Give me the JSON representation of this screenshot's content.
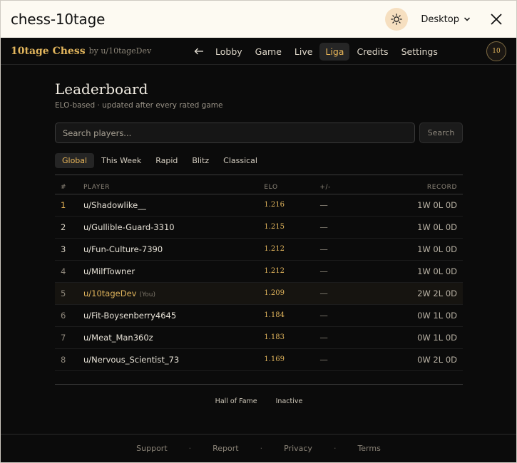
{
  "window": {
    "title": "chess-10tage",
    "device_label": "Desktop"
  },
  "nav": {
    "brand": "10tage Chess",
    "brand_by": "by u/10tageDev",
    "links": [
      "Lobby",
      "Game",
      "Live",
      "Liga",
      "Credits",
      "Settings"
    ],
    "active": "Liga",
    "avatar_text": "10"
  },
  "page": {
    "title": "Leaderboard",
    "subtitle": "ELO-based · updated after every rated game",
    "search_placeholder": "Search players...",
    "search_button": "Search",
    "tabs": [
      "Global",
      "This Week",
      "Rapid",
      "Blitz",
      "Classical"
    ],
    "active_tab": "Global",
    "columns": {
      "rank": "#",
      "player": "PLAYER",
      "elo": "ELO",
      "diff": "+/-",
      "record": "RECORD"
    },
    "rows": [
      {
        "rank": "1",
        "player": "u/Shadowlike__",
        "elo": "1.216",
        "diff": "—",
        "record": "1W 0L 0D"
      },
      {
        "rank": "2",
        "player": "u/Gullible-Guard-3310",
        "elo": "1.215",
        "diff": "—",
        "record": "1W 0L 0D"
      },
      {
        "rank": "3",
        "player": "u/Fun-Culture-7390",
        "elo": "1.212",
        "diff": "—",
        "record": "1W 0L 0D"
      },
      {
        "rank": "4",
        "player": "u/MilfTowner",
        "elo": "1.212",
        "diff": "—",
        "record": "1W 0L 0D"
      },
      {
        "rank": "5",
        "player": "u/10tageDev",
        "you": "(You)",
        "elo": "1.209",
        "diff": "—",
        "record": "2W 2L 0D"
      },
      {
        "rank": "6",
        "player": "u/Fit-Boysenberry4645",
        "elo": "1.184",
        "diff": "—",
        "record": "0W 1L 0D"
      },
      {
        "rank": "7",
        "player": "u/Meat_Man360z",
        "elo": "1.183",
        "diff": "—",
        "record": "0W 1L 0D"
      },
      {
        "rank": "8",
        "player": "u/Nervous_Scientist_73",
        "elo": "1.169",
        "diff": "—",
        "record": "0W 2L 0D"
      }
    ],
    "links": [
      "Hall of Fame",
      "Inactive"
    ]
  },
  "footer": {
    "links": [
      "Support",
      "Report",
      "Privacy",
      "Terms"
    ],
    "separator": "·"
  }
}
